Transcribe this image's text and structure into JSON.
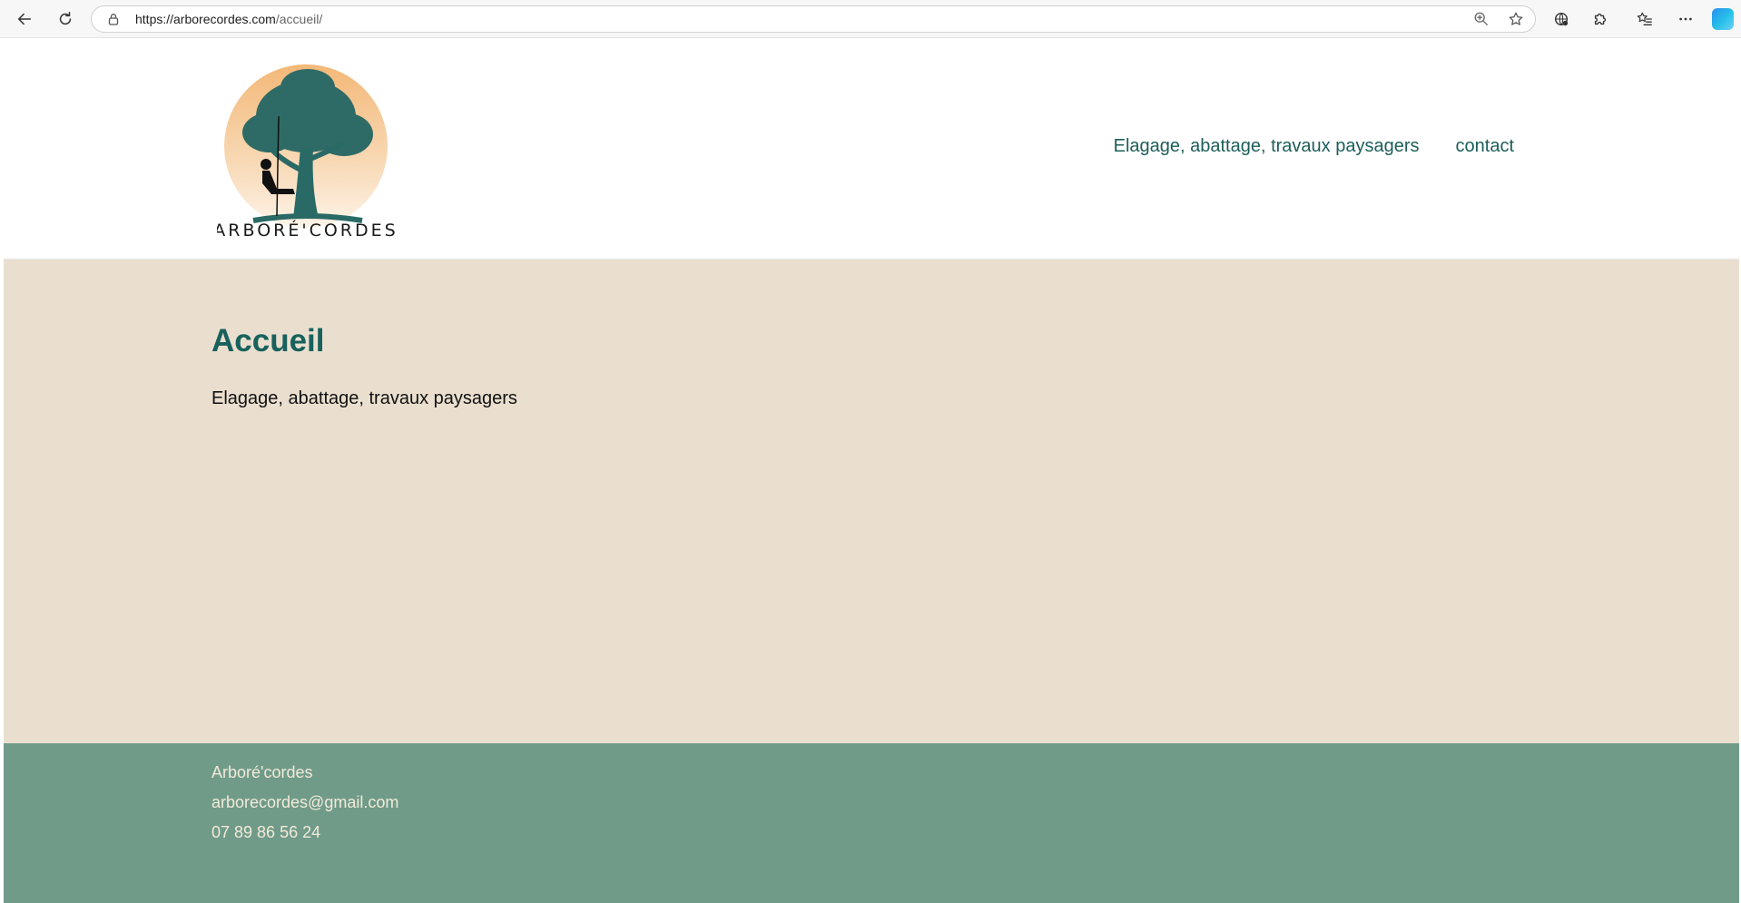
{
  "browser": {
    "url_host": "https://arborecordes.com",
    "url_path": "/accueil/"
  },
  "site": {
    "logo_text": "ARBORÉ'CORDES",
    "nav": [
      {
        "label": "Elagage, abattage, travaux paysagers"
      },
      {
        "label": "contact"
      }
    ]
  },
  "page": {
    "title": "Accueil",
    "subtitle": "Elagage, abattage, travaux paysagers"
  },
  "footer": {
    "name": "Arboré'cordes",
    "email": "arborecordes@gmail.com",
    "phone": "07 89 86 56 24"
  },
  "colors": {
    "brand_teal": "#1c5e59",
    "content_bg": "#eadfcf",
    "footer_bg": "#709b89",
    "footer_text": "#f3ead9"
  }
}
